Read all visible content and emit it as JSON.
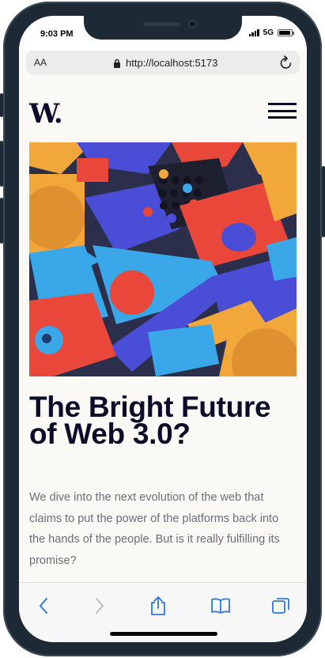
{
  "status_bar": {
    "time": "9:03 PM",
    "network": "5G"
  },
  "browser": {
    "text_size_label": "AA",
    "url": "http://localhost:5173"
  },
  "site": {
    "logo": "W.",
    "menu_icon": "hamburger-menu-icon"
  },
  "article": {
    "image_description_icon": "colorful-3d-blocks-illustration",
    "title": "The Bright Future of Web 3.0?",
    "description": "We dive into the next evolution of the web that claims to put the power of the platforms back into the hands of the people. But is it really fulfilling its promise?"
  },
  "toolbar": {
    "back_icon": "chevron-left-icon",
    "forward_icon": "chevron-right-icon",
    "share_icon": "share-icon",
    "bookmarks_icon": "book-icon",
    "tabs_icon": "tabs-icon"
  },
  "colors": {
    "accent": "#0d0d2b",
    "link": "#2f7ad8",
    "background": "#fbf9f5"
  }
}
